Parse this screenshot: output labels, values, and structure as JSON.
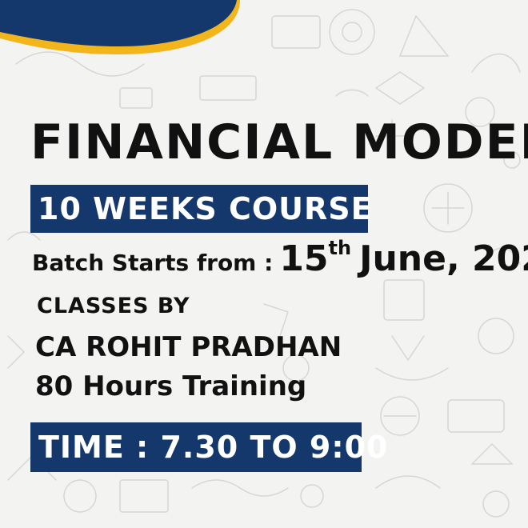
{
  "colors": {
    "navy": "#14386c",
    "accent_yellow": "#f3b51c",
    "text": "#111111",
    "background": "#f3f3f2"
  },
  "title": "FINANCIAL MODEL",
  "course_badge": "10 WEEKS COURSE",
  "batch": {
    "label": "Batch Starts from :",
    "day": "15",
    "day_suffix": "th",
    "month_year": "June, 202"
  },
  "classes_by": "CLASSES BY",
  "instructor": "CA ROHIT PRADHAN",
  "hours": "80 Hours Training",
  "time_badge": "TIME : 7.30 TO 9:00"
}
